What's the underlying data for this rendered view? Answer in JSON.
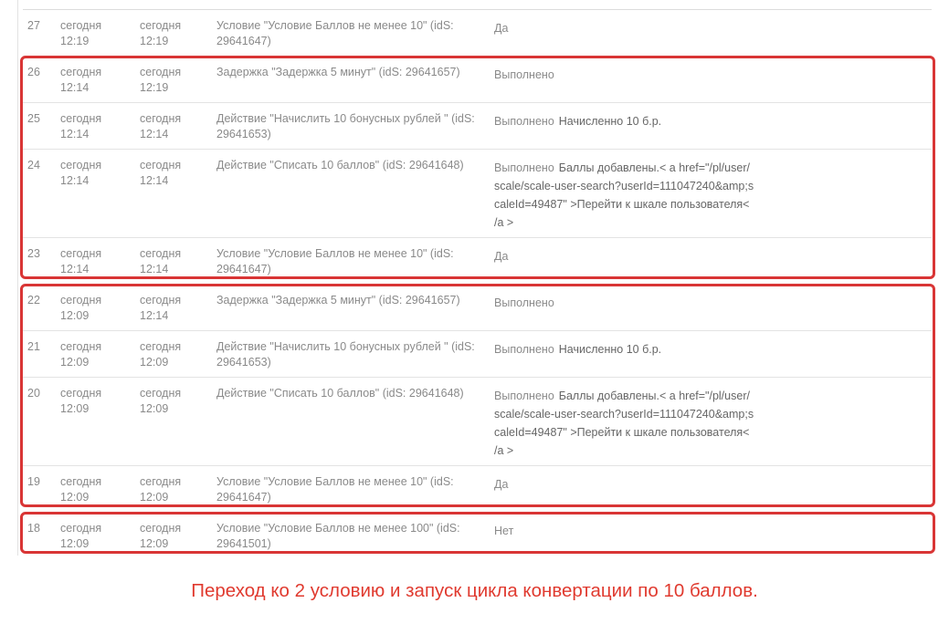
{
  "rows": [
    {
      "id": "27",
      "start_day": "сегодня",
      "start_time": "12:19",
      "end_day": "сегодня",
      "end_time": "12:19",
      "step": "Условие \"Условие Баллов не менее 10\" (idS: 29641647)",
      "status": "Да",
      "result": ""
    },
    {
      "id": "26",
      "start_day": "сегодня",
      "start_time": "12:14",
      "end_day": "сегодня",
      "end_time": "12:19",
      "step": "Задержка \"Задержка 5 минут\" (idS: 29641657)",
      "status": "Выполнено",
      "result": ""
    },
    {
      "id": "25",
      "start_day": "сегодня",
      "start_time": "12:14",
      "end_day": "сегодня",
      "end_time": "12:14",
      "step": "Действие \"Начислить 10 бонусных рублей \" (idS: 29641653)",
      "status": "Выполнено",
      "result": "Начисленно 10 б.р."
    },
    {
      "id": "24",
      "start_day": "сегодня",
      "start_time": "12:14",
      "end_day": "сегодня",
      "end_time": "12:14",
      "step": "Действие \"Списать 10 баллов\" (idS: 29641648)",
      "status": "Выполнено",
      "result": "Баллы добавлены.< a href=\"/pl/user/scale/scale-user-search?userId=111047240&amp;scaleId=49487\" >Перейти к шкале пользователя< /a >"
    },
    {
      "id": "23",
      "start_day": "сегодня",
      "start_time": "12:14",
      "end_day": "сегодня",
      "end_time": "12:14",
      "step": "Условие \"Условие Баллов не менее 10\" (idS: 29641647)",
      "status": "Да",
      "result": ""
    },
    {
      "id": "22",
      "start_day": "сегодня",
      "start_time": "12:09",
      "end_day": "сегодня",
      "end_time": "12:14",
      "step": "Задержка \"Задержка 5 минут\" (idS: 29641657)",
      "status": "Выполнено",
      "result": ""
    },
    {
      "id": "21",
      "start_day": "сегодня",
      "start_time": "12:09",
      "end_day": "сегодня",
      "end_time": "12:09",
      "step": "Действие \"Начислить 10 бонусных рублей \" (idS: 29641653)",
      "status": "Выполнено",
      "result": "Начисленно 10 б.р."
    },
    {
      "id": "20",
      "start_day": "сегодня",
      "start_time": "12:09",
      "end_day": "сегодня",
      "end_time": "12:09",
      "step": "Действие \"Списать 10 баллов\" (idS: 29641648)",
      "status": "Выполнено",
      "result": "Баллы добавлены.< a href=\"/pl/user/scale/scale-user-search?userId=111047240&amp;scaleId=49487\" >Перейти к шкале пользователя< /a >"
    },
    {
      "id": "19",
      "start_day": "сегодня",
      "start_time": "12:09",
      "end_day": "сегодня",
      "end_time": "12:09",
      "step": "Условие \"Условие Баллов не менее 10\" (idS: 29641647)",
      "status": "Да",
      "result": ""
    },
    {
      "id": "18",
      "start_day": "сегодня",
      "start_time": "12:09",
      "end_day": "сегодня",
      "end_time": "12:09",
      "step": "Условие \"Условие Баллов не менее 100\" (idS: 29641501)",
      "status": "Нет",
      "result": ""
    }
  ],
  "annotation": {
    "caption": "Переход ко 2 условию и запуск цикла конвертации по 10 баллов.",
    "highlight_color": "#d93535"
  }
}
